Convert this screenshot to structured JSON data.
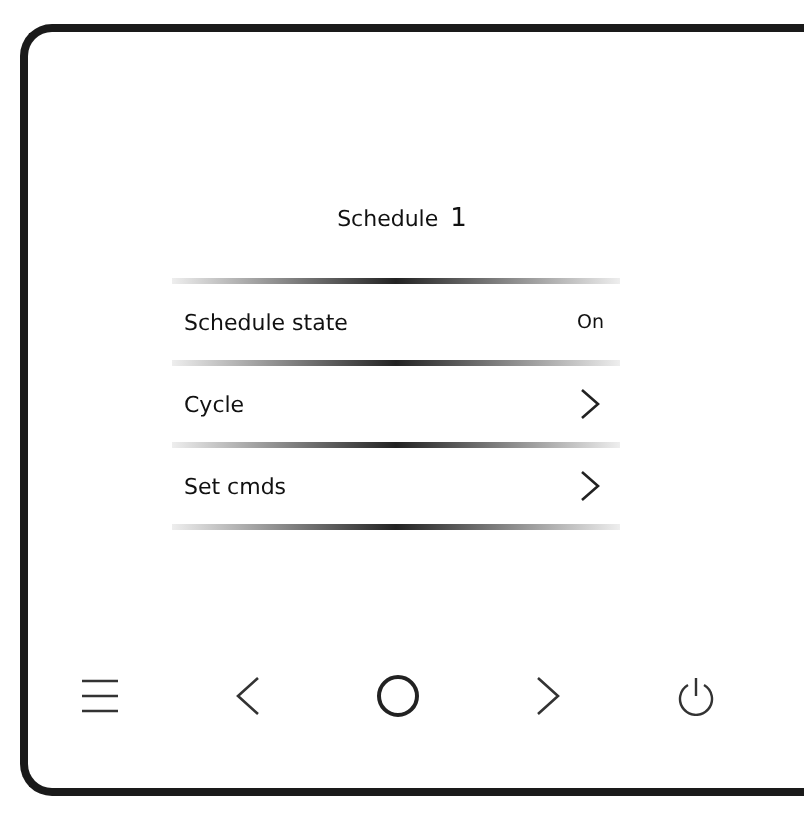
{
  "header": {
    "label": "Schedule",
    "number": "1"
  },
  "rows": [
    {
      "kind": "value",
      "label": "Schedule state",
      "value": "On"
    },
    {
      "kind": "link",
      "label": "Cycle"
    },
    {
      "kind": "link",
      "label": "Set cmds"
    }
  ],
  "keys": [
    {
      "kind": "menu"
    },
    {
      "kind": "back"
    },
    {
      "kind": "home"
    },
    {
      "kind": "forward"
    },
    {
      "kind": "power"
    }
  ]
}
